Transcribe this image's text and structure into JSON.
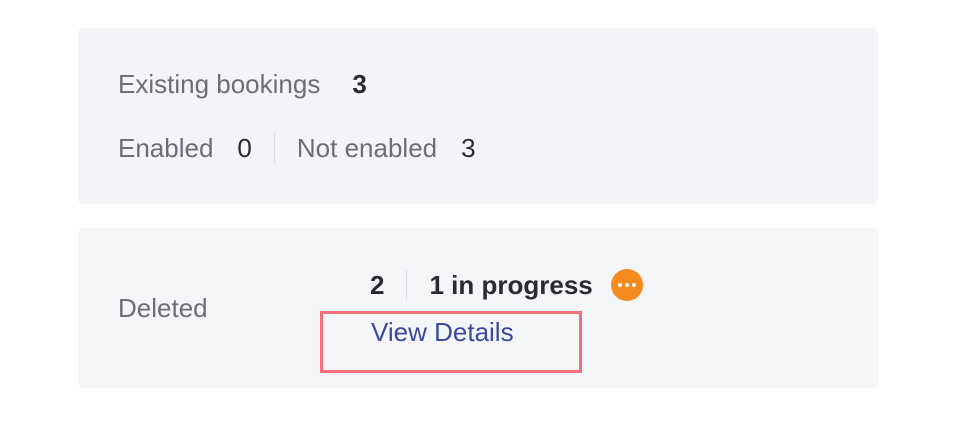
{
  "bookings": {
    "existing_label": "Existing bookings",
    "existing_count": "3",
    "enabled_label": "Enabled",
    "enabled_count": "0",
    "not_enabled_label": "Not enabled",
    "not_enabled_count": "3"
  },
  "deleted": {
    "label": "Deleted",
    "count": "2",
    "in_progress": "1 in progress",
    "more_icon": "more-horizontal-icon",
    "more_icon_color": "#f58a1f",
    "link_label": "View Details",
    "link_color": "#3b4a9a"
  },
  "highlight": {
    "color": "#f2707a"
  }
}
